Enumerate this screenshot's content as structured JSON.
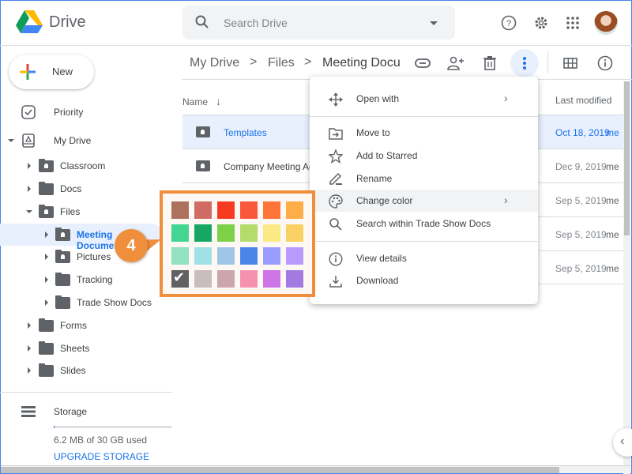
{
  "app": {
    "name": "Drive"
  },
  "search": {
    "placeholder": "Search Drive"
  },
  "header_icons": [
    "help-icon",
    "settings-icon",
    "apps-icon",
    "avatar"
  ],
  "sidebar": {
    "new_label": "New",
    "items": [
      {
        "label": "Priority",
        "icon": "priority-icon"
      },
      {
        "label": "My Drive",
        "icon": "my-drive-icon",
        "expanded": true
      },
      {
        "label": "Classroom",
        "shared": true
      },
      {
        "label": "Docs"
      },
      {
        "label": "Files",
        "shared": true,
        "expanded": true
      },
      {
        "label": "Meeting Documen...",
        "shared": true,
        "selected": true
      },
      {
        "label": "Pictures",
        "shared": true
      },
      {
        "label": "Tracking"
      },
      {
        "label": "Trade Show Docs"
      },
      {
        "label": "Forms"
      },
      {
        "label": "Sheets"
      },
      {
        "label": "Slides"
      }
    ],
    "storage": {
      "label": "Storage",
      "used_text": "6.2 MB of 30 GB used",
      "used_fraction": 0.0002,
      "upgrade_label": "UPGRADE STORAGE"
    }
  },
  "breadcrumb": {
    "items": [
      "My Drive",
      "Files",
      "Meeting Docu"
    ],
    "separator": ">"
  },
  "toolbar_icons": [
    "link-icon",
    "share-icon",
    "trash-icon",
    "more-vert-icon",
    "grid-view-icon",
    "info-icon"
  ],
  "table": {
    "columns": {
      "name": "Name",
      "sort_arrow": "↓",
      "modified": "Last modified"
    },
    "rows": [
      {
        "name": "Templates",
        "date": "Oct 18, 2019",
        "owner": "me",
        "selected": true
      },
      {
        "name": "Company Meeting Agenda",
        "date": "Dec 9, 2019",
        "owner": "me"
      },
      {
        "name": "",
        "date": "Sep 5, 2019",
        "owner": "me"
      },
      {
        "name": "",
        "date": "Sep 5, 2019",
        "owner": "me"
      },
      {
        "name": "",
        "date": "Sep 5, 2019",
        "owner": "me"
      }
    ]
  },
  "context_menu": {
    "items": [
      {
        "label": "Open with",
        "icon": "open-with-icon",
        "submenu": true
      },
      {
        "label": "Move to",
        "icon": "move-to-icon"
      },
      {
        "label": "Add to Starred",
        "icon": "star-icon"
      },
      {
        "label": "Rename",
        "icon": "rename-icon"
      },
      {
        "label": "Change color",
        "icon": "palette-icon",
        "submenu": true,
        "hover": true
      },
      {
        "label": "Search within Trade Show Docs",
        "icon": "search-icon"
      },
      {
        "label": "View details",
        "icon": "info-icon"
      },
      {
        "label": "Download",
        "icon": "download-icon"
      }
    ],
    "chevron": "›"
  },
  "color_palette": {
    "colors": [
      [
        "#ac725e",
        "#d06b64",
        "#f83a22",
        "#fa573c",
        "#ff7537",
        "#ffad46"
      ],
      [
        "#42d692",
        "#16a765",
        "#7bd148",
        "#b3dc6c",
        "#fbe983",
        "#fad165"
      ],
      [
        "#92e1c0",
        "#9fe1e7",
        "#9fc6e7",
        "#4986e7",
        "#9a9cff",
        "#b99aff"
      ],
      [
        "#616161",
        "#cabdbf",
        "#cca6ac",
        "#f691b2",
        "#cd74e6",
        "#a47ae2"
      ]
    ],
    "selected": "#616161"
  },
  "callout": {
    "step": "4"
  }
}
